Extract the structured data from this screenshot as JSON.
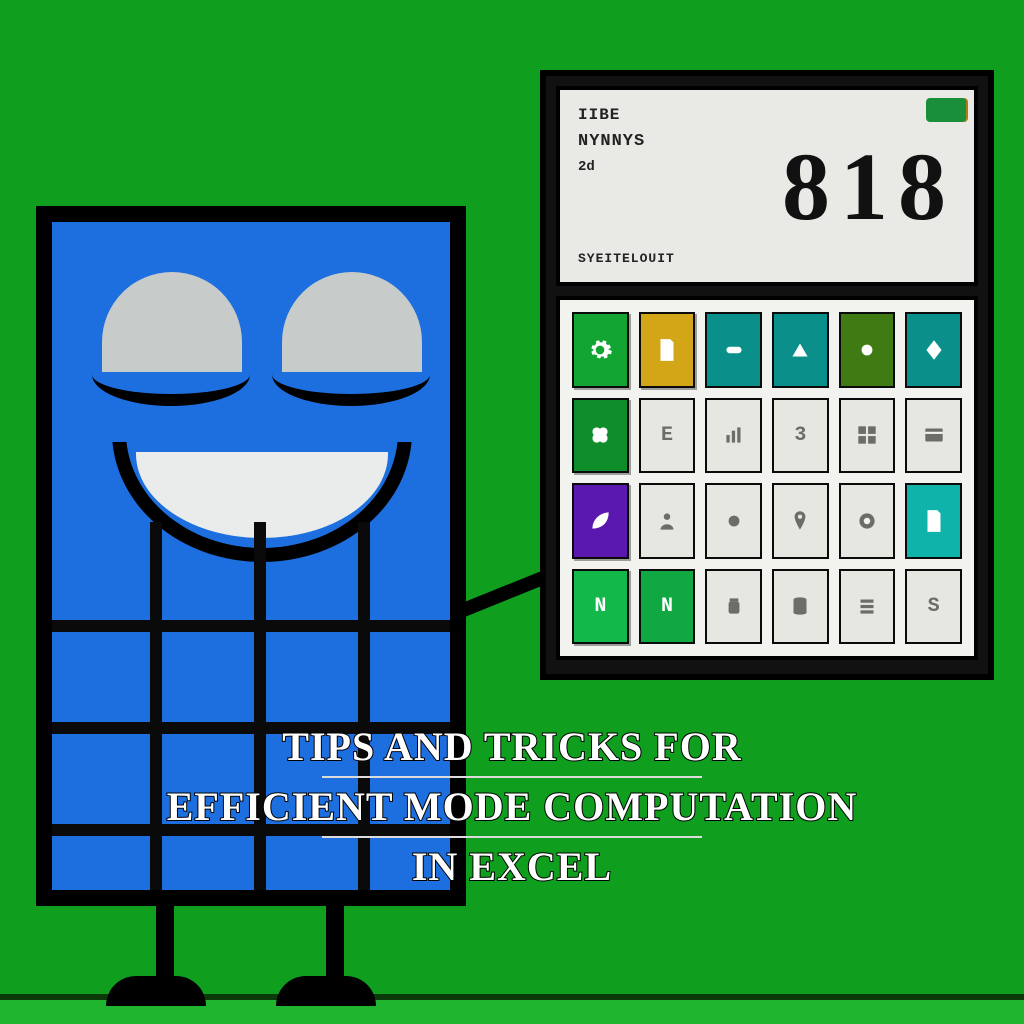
{
  "caption": {
    "line1": "Tips and Tricks for",
    "line2": "Efficient Mode Computation",
    "line3": "in Excel"
  },
  "calculator": {
    "screen": {
      "label1": "IIBE",
      "label2": "NYNNYS",
      "label3": "2d",
      "label4": "SYEITELOUIT",
      "value": "818"
    },
    "keys": [
      {
        "name": "key-r1c1",
        "cls": "green1 shadow",
        "icon": "gear"
      },
      {
        "name": "key-r1c2",
        "cls": "mustard shadow",
        "icon": "doc"
      },
      {
        "name": "key-r1c3",
        "cls": "teal",
        "icon": "pill"
      },
      {
        "name": "key-r1c4",
        "cls": "teal",
        "icon": "tri"
      },
      {
        "name": "key-r1c5",
        "cls": "olive",
        "icon": "dot"
      },
      {
        "name": "key-r1c6",
        "cls": "teal",
        "icon": "diamond"
      },
      {
        "name": "key-r2c1",
        "cls": "green2 shadow",
        "icon": "clover"
      },
      {
        "name": "key-r2c2",
        "cls": "gray",
        "text": "E"
      },
      {
        "name": "key-r2c3",
        "cls": "gray",
        "icon": "bars"
      },
      {
        "name": "key-r2c4",
        "cls": "gray",
        "text": "3"
      },
      {
        "name": "key-r2c5",
        "cls": "gray",
        "icon": "grid"
      },
      {
        "name": "key-r2c6",
        "cls": "gray",
        "icon": "card"
      },
      {
        "name": "key-r3c1",
        "cls": "purple shadow",
        "icon": "leaf"
      },
      {
        "name": "key-r3c2",
        "cls": "gray",
        "icon": "person"
      },
      {
        "name": "key-r3c3",
        "cls": "gray",
        "icon": "dot"
      },
      {
        "name": "key-r3c4",
        "cls": "gray",
        "icon": "pin"
      },
      {
        "name": "key-r3c5",
        "cls": "gray",
        "icon": "coin"
      },
      {
        "name": "key-r3c6",
        "cls": "tealL",
        "icon": "doc"
      },
      {
        "name": "key-r4c1",
        "cls": "green3 shadow",
        "text": "N"
      },
      {
        "name": "key-r4c2",
        "cls": "green4",
        "text": "N"
      },
      {
        "name": "key-r4c3",
        "cls": "gray",
        "icon": "jar"
      },
      {
        "name": "key-r4c4",
        "cls": "gray",
        "icon": "barrel"
      },
      {
        "name": "key-r4c5",
        "cls": "gray",
        "icon": "stack"
      },
      {
        "name": "key-r4c6",
        "cls": "gray",
        "text": "S"
      }
    ]
  },
  "colors": {
    "bg": "#0f9e1d",
    "character": "#1d6fe0"
  }
}
